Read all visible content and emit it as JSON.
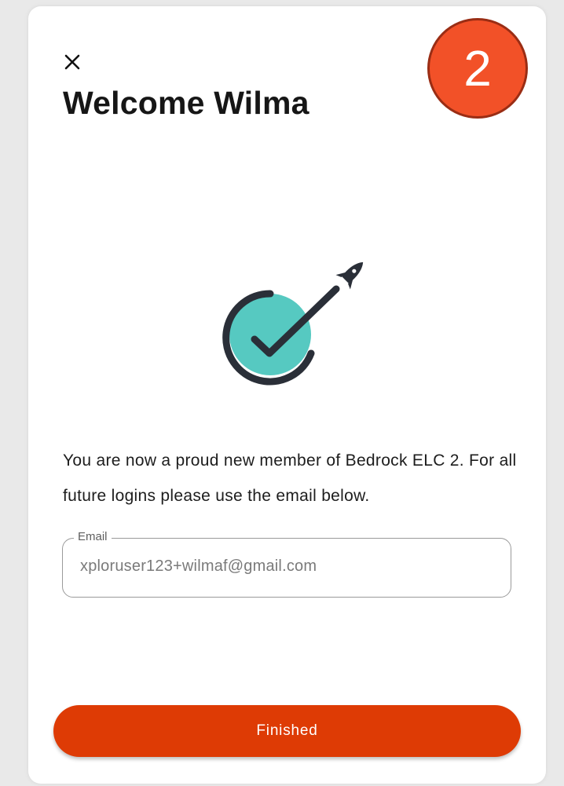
{
  "dialog": {
    "title": "Welcome Wilma",
    "step_number": "2",
    "message": "You are now a proud new member of Bedrock ELC 2. For all future logins please use the email below.",
    "close_icon": "close-icon",
    "illustration_icon": "rocket-checkmark-icon"
  },
  "email_field": {
    "label": "Email",
    "value": "xploruser123+wilmaf@gmail.com"
  },
  "actions": {
    "finish_label": "Finished"
  },
  "colors": {
    "accent": "#de3b05",
    "badge": "#f25128",
    "teal": "#56c9c1",
    "dark": "#2a2f38"
  }
}
